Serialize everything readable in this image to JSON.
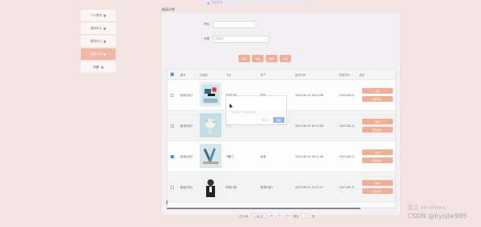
{
  "topbar": {
    "hint": "订阅说明"
  },
  "sidebar": {
    "items": [
      {
        "label": "个人首页",
        "active": false
      },
      {
        "label": "首页中心",
        "active": false
      },
      {
        "label": "图书中心",
        "active": false
      },
      {
        "label": "阅读计划",
        "active": true
      },
      {
        "label": "收藏",
        "active": false
      }
    ]
  },
  "page": {
    "title": "阅读计划"
  },
  "search": {
    "label1": "书名",
    "input1_placeholder": "",
    "label2": "分类",
    "input2_placeholder": "请选择"
  },
  "actions": [
    "查询",
    "添加",
    "删除",
    "导出"
  ],
  "table": {
    "headers": [
      "编号",
      "封面图",
      "书名",
      "用户",
      "阅读时间",
      "结束时间",
      "操作"
    ],
    "rows": [
      {
        "no": "阅读计划1",
        "name": "阅读计划",
        "user": "用户",
        "time": "2023-08-10 16:21:08",
        "end": "2023-08-10",
        "checked": false
      },
      {
        "no": "阅读计划2",
        "name": "书名二",
        "user": "",
        "time": "2023-08-10 16:21:08",
        "end": "2023-08-10",
        "checked": false
      },
      {
        "no": "阅读计划3",
        "name": "书籍三",
        "user": "阅读",
        "time": "2023-08-10 16:21:08",
        "end": "2023-08-10",
        "checked": true
      },
      {
        "no": "阅读计划4",
        "name": "阅读计划",
        "user": "阅读计划1",
        "time": "2023-08-10 15:52:47",
        "end": "2023-08-10",
        "checked": false
      }
    ],
    "op_labels": [
      "详情",
      "阅读评价"
    ]
  },
  "pager": {
    "total": "共 4 条",
    "size": "10条/页",
    "prev": "<",
    "page": "1",
    "next": ">",
    "goto_label": "前往",
    "goto_value": "1",
    "goto_suffix": "页"
  },
  "tooltip": {
    "text": "请选择一个阅读计划",
    "cancel": "取消",
    "confirm": "确定"
  },
  "watermark": {
    "line1": "激活 Windows",
    "line2": "CSDN @bysjlw985"
  },
  "colors": {
    "accent": "#f2ad95",
    "sidebar_active": "#f2b6a3",
    "checked": "#4a8ff5"
  }
}
